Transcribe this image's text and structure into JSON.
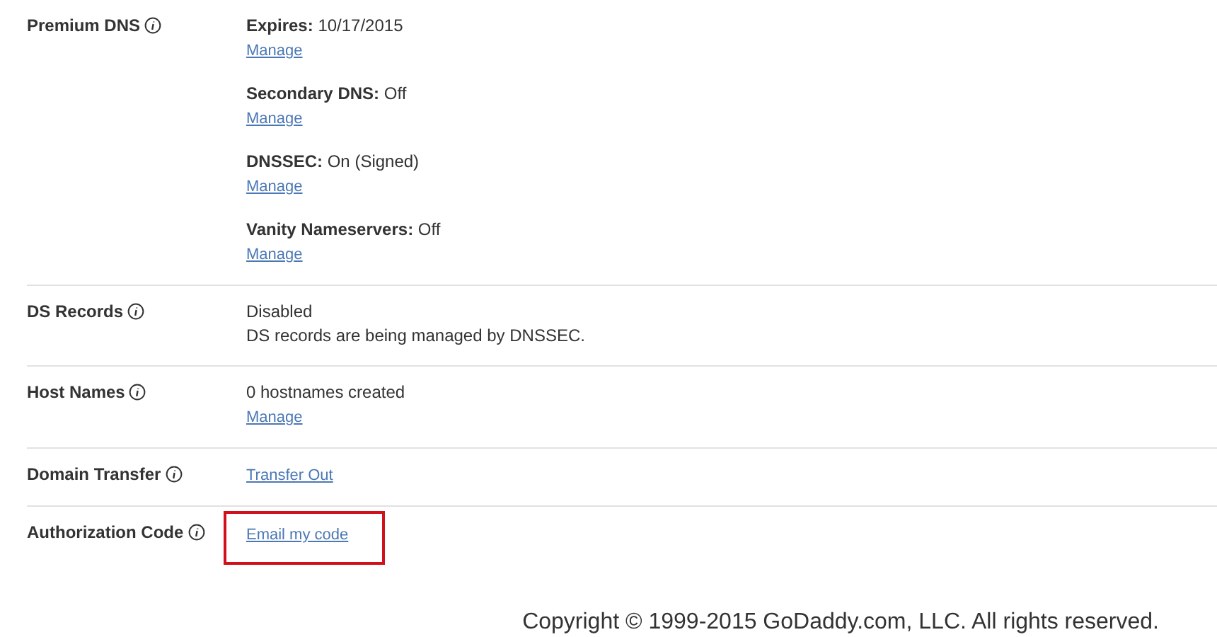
{
  "rows": [
    {
      "label": "Premium DNS",
      "highlighted": false,
      "groups": [
        [
          {
            "kind": "field",
            "label": "Expires:",
            "value": "10/17/2015"
          },
          {
            "kind": "link",
            "text": "Manage"
          }
        ],
        [
          {
            "kind": "field",
            "label": "Secondary DNS:",
            "value": "Off"
          },
          {
            "kind": "link",
            "text": "Manage"
          }
        ],
        [
          {
            "kind": "field",
            "label": "DNSSEC:",
            "value": "On (Signed)"
          },
          {
            "kind": "link",
            "text": "Manage"
          }
        ],
        [
          {
            "kind": "field",
            "label": "Vanity Nameservers:",
            "value": "Off"
          },
          {
            "kind": "link",
            "text": "Manage"
          }
        ]
      ]
    },
    {
      "label": "DS Records",
      "highlighted": false,
      "groups": [
        [
          {
            "kind": "text",
            "text": "Disabled"
          },
          {
            "kind": "text",
            "text": "DS records are being managed by DNSSEC."
          }
        ]
      ]
    },
    {
      "label": "Host Names",
      "highlighted": false,
      "groups": [
        [
          {
            "kind": "text",
            "text": "0 hostnames created"
          },
          {
            "kind": "link",
            "text": "Manage"
          }
        ]
      ]
    },
    {
      "label": "Domain Transfer",
      "highlighted": false,
      "groups": [
        [
          {
            "kind": "link",
            "text": "Transfer Out"
          }
        ]
      ]
    },
    {
      "label": "Authorization Code",
      "highlighted": true,
      "groups": [
        [
          {
            "kind": "link",
            "text": "Email my code"
          }
        ]
      ]
    }
  ],
  "footer": {
    "copyright": "Copyright © 1999-2015 GoDaddy.com, LLC. All rights reserved."
  }
}
